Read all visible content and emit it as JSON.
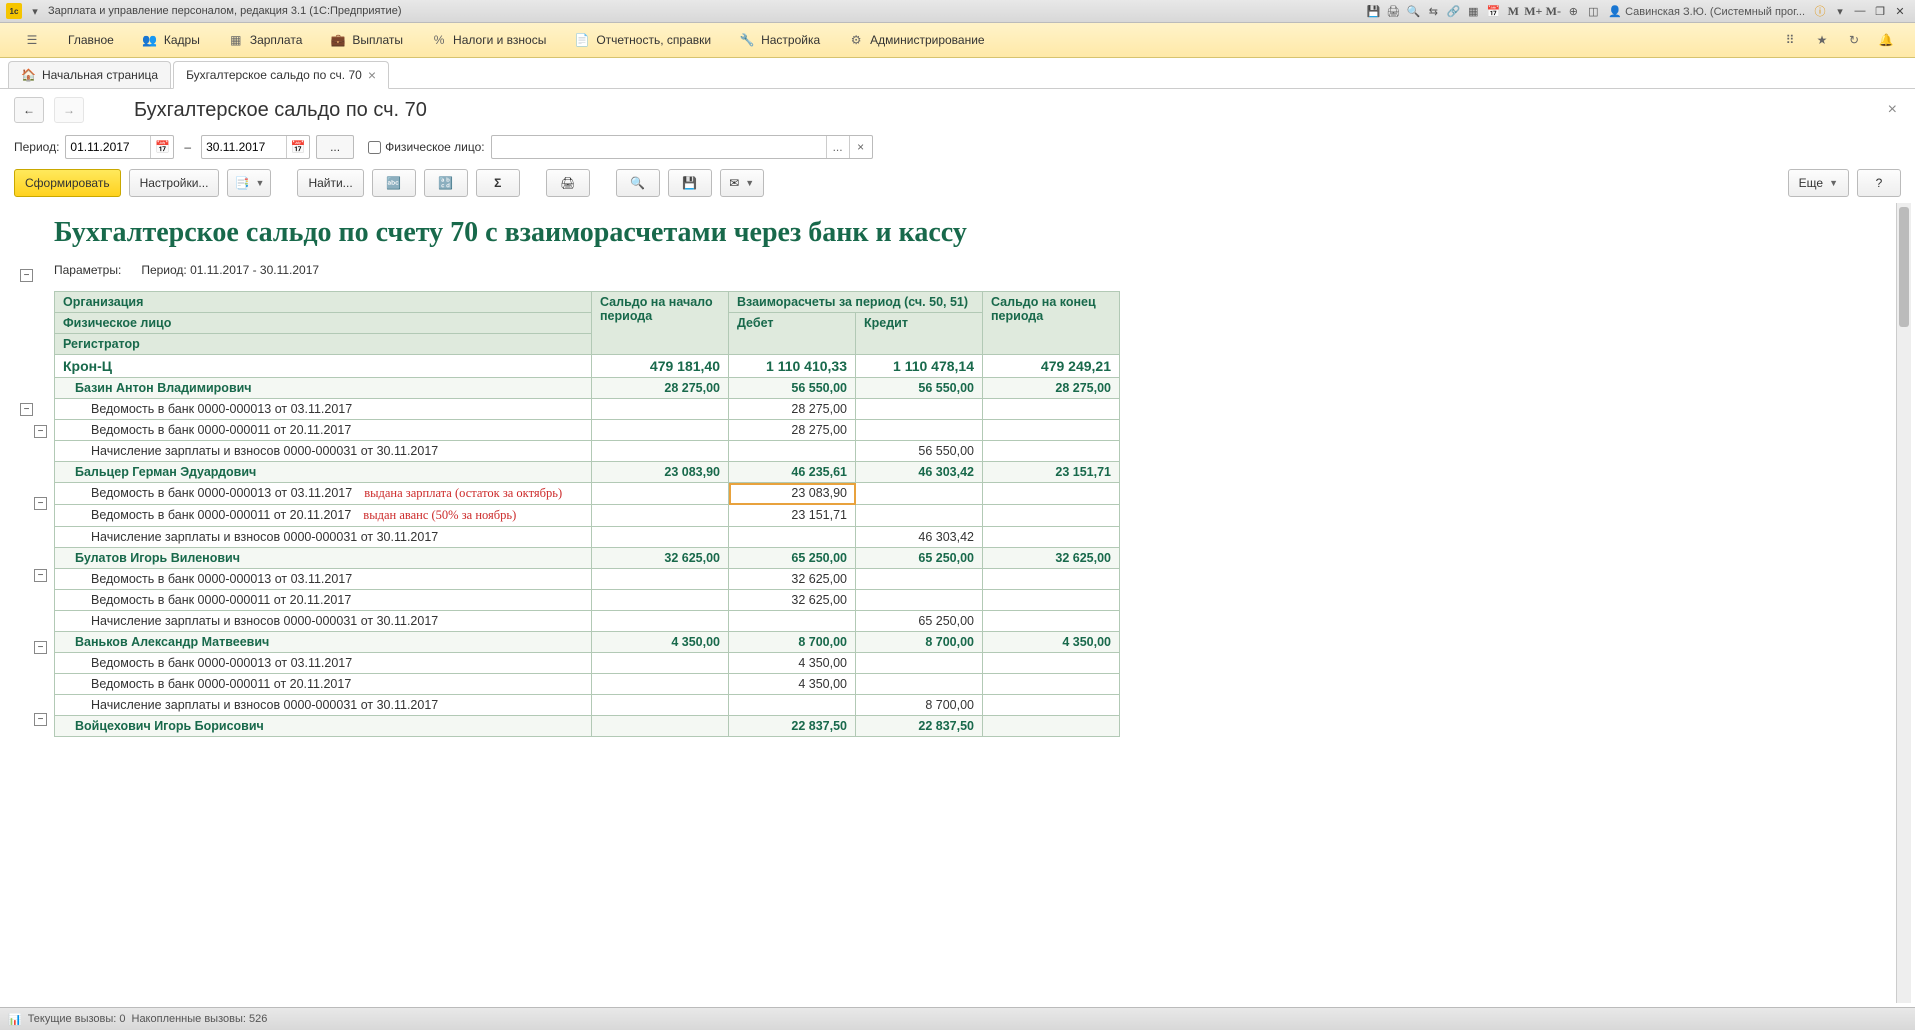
{
  "window": {
    "title": "Зарплата и управление персоналом, редакция 3.1  (1С:Предприятие)",
    "user": "Савинская З.Ю. (Системный прог..."
  },
  "mainmenu": [
    "Главное",
    "Кадры",
    "Зарплата",
    "Выплаты",
    "Налоги и взносы",
    "Отчетность, справки",
    "Настройка",
    "Администрирование"
  ],
  "tabs": {
    "home": "Начальная страница",
    "active": "Бухгалтерское сальдо по сч. 70"
  },
  "page": {
    "title": "Бухгалтерское сальдо по сч. 70",
    "period_label": "Период:",
    "date_from": "01.11.2017",
    "date_to": "30.11.2017",
    "person_label": "Физическое лицо:",
    "person_value": ""
  },
  "toolbar": {
    "generate": "Сформировать",
    "settings": "Настройки...",
    "find": "Найти...",
    "more": "Еще",
    "help": "?"
  },
  "report": {
    "title": "Бухгалтерское сальдо по счету 70 с взаиморасчетами через банк и кассу",
    "params_label": "Параметры:",
    "params_period": "Период: 01.11.2017 - 30.11.2017",
    "headers": {
      "org": "Организация",
      "person": "Физическое лицо",
      "reg": "Регистратор",
      "start": "Сальдо на начало периода",
      "settlements": "Взаиморасчеты за период (сч. 50, 51)",
      "debit": "Дебет",
      "credit": "Кредит",
      "end": "Сальдо на конец периода"
    },
    "total": {
      "name": "Крон-Ц",
      "start": "479 181,40",
      "debit": "1 110 410,33",
      "credit": "1 110 478,14",
      "end": "479 249,21"
    },
    "groups": [
      {
        "person": "Базин Антон Владимирович",
        "start": "28 275,00",
        "debit": "56 550,00",
        "credit": "56 550,00",
        "end": "28 275,00",
        "rows": [
          {
            "name": "Ведомость в банк 0000-000013 от 03.11.2017",
            "debit": "28 275,00"
          },
          {
            "name": "Ведомость в банк 0000-000011 от 20.11.2017",
            "debit": "28 275,00"
          },
          {
            "name": "Начисление зарплаты и взносов 0000-000031 от 30.11.2017",
            "credit": "56 550,00"
          }
        ]
      },
      {
        "person": "Бальцер Герман Эдуардович",
        "start": "23 083,90",
        "debit": "46 235,61",
        "credit": "46 303,42",
        "end": "23 151,71",
        "rows": [
          {
            "name": "Ведомость в банк 0000-000013 от 03.11.2017",
            "anno": "выдана зарплата (остаток за октябрь)",
            "debit": "23 083,90",
            "hl": true
          },
          {
            "name": "Ведомость в банк 0000-000011 от 20.11.2017",
            "anno": "выдан аванс (50% за ноябрь)",
            "debit": "23 151,71"
          },
          {
            "name": "Начисление зарплаты и взносов 0000-000031 от 30.11.2017",
            "credit": "46 303,42"
          }
        ]
      },
      {
        "person": "Булатов Игорь Виленович",
        "start": "32 625,00",
        "debit": "65 250,00",
        "credit": "65 250,00",
        "end": "32 625,00",
        "rows": [
          {
            "name": "Ведомость в банк 0000-000013 от 03.11.2017",
            "debit": "32 625,00"
          },
          {
            "name": "Ведомость в банк 0000-000011 от 20.11.2017",
            "debit": "32 625,00"
          },
          {
            "name": "Начисление зарплаты и взносов 0000-000031 от 30.11.2017",
            "credit": "65 250,00"
          }
        ]
      },
      {
        "person": "Ваньков Александр Матвеевич",
        "start": "4 350,00",
        "debit": "8 700,00",
        "credit": "8 700,00",
        "end": "4 350,00",
        "rows": [
          {
            "name": "Ведомость в банк 0000-000013 от 03.11.2017",
            "debit": "4 350,00"
          },
          {
            "name": "Ведомость в банк 0000-000011 от 20.11.2017",
            "debit": "4 350,00"
          },
          {
            "name": "Начисление зарплаты и взносов 0000-000031 от 30.11.2017",
            "credit": "8 700,00"
          }
        ]
      },
      {
        "person": "Войцехович Игорь Борисович",
        "start": "",
        "debit": "22 837,50",
        "credit": "22 837,50",
        "end": "",
        "rows": []
      }
    ]
  },
  "status": {
    "current": "Текущие вызовы: 0",
    "accum": "Накопленные вызовы: 526"
  }
}
